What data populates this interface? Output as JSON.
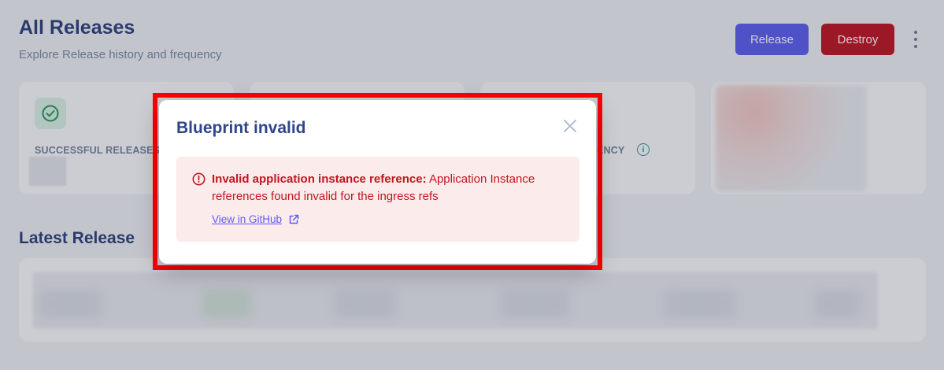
{
  "header": {
    "title": "All Releases",
    "subtitle": "Explore Release history and frequency",
    "release_button": "Release",
    "destroy_button": "Destroy"
  },
  "stats": {
    "successful_label": "SUCCESSFUL RELEASES",
    "frequency_label": "ENCY"
  },
  "latest": {
    "title": "Latest Release"
  },
  "modal": {
    "title": "Blueprint invalid",
    "error_heading": "Invalid application instance reference",
    "error_message": "Application Instance references found invalid for the ingress refs",
    "link_label": "View in GitHub"
  },
  "colors": {
    "primary": "#5b5ef0",
    "danger": "#c1121f",
    "error_text": "#c0151f",
    "error_bg": "#fcebeb",
    "title": "#2f4689",
    "highlight": "#ff0000"
  },
  "icons": {
    "check": "check-circle-icon",
    "info": "info-icon",
    "close": "close-icon",
    "error": "error-circle-icon",
    "external": "external-link-icon",
    "more": "kebab-menu-icon"
  }
}
